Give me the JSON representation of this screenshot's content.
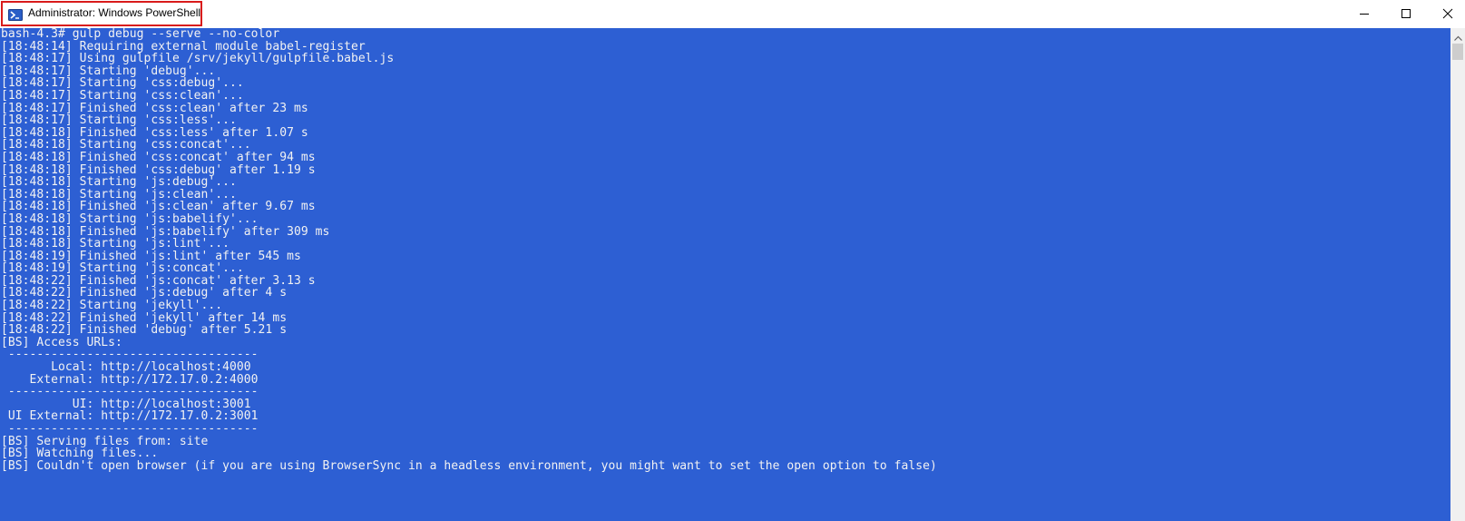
{
  "window": {
    "title": "Administrator: Windows PowerShell",
    "app_icon": "powershell-icon",
    "caption_buttons": {
      "minimize_icon": "minimize-icon",
      "maximize_icon": "maximize-icon",
      "close_icon": "close-icon"
    }
  },
  "colors": {
    "console_background": "#2d5fd3",
    "console_text": "#f2f2f2",
    "highlight_border": "#d91b1b"
  },
  "console": {
    "lines": [
      "bash-4.3# gulp debug --serve --no-color",
      "[18:48:14] Requiring external module babel-register",
      "[18:48:17] Using gulpfile /srv/jekyll/gulpfile.babel.js",
      "[18:48:17] Starting 'debug'...",
      "[18:48:17] Starting 'css:debug'...",
      "[18:48:17] Starting 'css:clean'...",
      "[18:48:17] Finished 'css:clean' after 23 ms",
      "[18:48:17] Starting 'css:less'...",
      "[18:48:18] Finished 'css:less' after 1.07 s",
      "[18:48:18] Starting 'css:concat'...",
      "[18:48:18] Finished 'css:concat' after 94 ms",
      "[18:48:18] Finished 'css:debug' after 1.19 s",
      "[18:48:18] Starting 'js:debug'...",
      "[18:48:18] Starting 'js:clean'...",
      "[18:48:18] Finished 'js:clean' after 9.67 ms",
      "[18:48:18] Starting 'js:babelify'...",
      "[18:48:18] Finished 'js:babelify' after 309 ms",
      "[18:48:18] Starting 'js:lint'...",
      "[18:48:19] Finished 'js:lint' after 545 ms",
      "[18:48:19] Starting 'js:concat'...",
      "[18:48:22] Finished 'js:concat' after 3.13 s",
      "[18:48:22] Finished 'js:debug' after 4 s",
      "[18:48:22] Starting 'jekyll'...",
      "[18:48:22] Finished 'jekyll' after 14 ms",
      "[18:48:22] Finished 'debug' after 5.21 s",
      "[BS] Access URLs:",
      " -----------------------------------",
      "       Local: http://localhost:4000",
      "    External: http://172.17.0.2:4000",
      " -----------------------------------",
      "          UI: http://localhost:3001",
      " UI External: http://172.17.0.2:3001",
      " -----------------------------------",
      "[BS] Serving files from: site",
      "[BS] Watching files...",
      "[BS] Couldn't open browser (if you are using BrowserSync in a headless environment, you might want to set the open option to false)"
    ]
  }
}
